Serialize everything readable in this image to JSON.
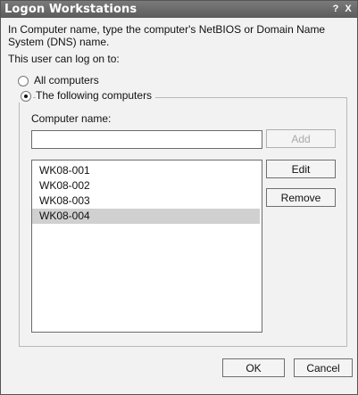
{
  "window": {
    "title": "Logon Workstations",
    "help_glyph": "?",
    "close_glyph": "X"
  },
  "description": "In Computer name, type the computer's NetBIOS or Domain Name System (DNS) name.",
  "can_log_on_label": "This user can log on to:",
  "options": {
    "all_label": "All computers",
    "following_label": "The following computers",
    "selected": "following"
  },
  "computer_name": {
    "label": "Computer name:",
    "value": ""
  },
  "buttons": {
    "add": "Add",
    "edit": "Edit",
    "remove": "Remove",
    "ok": "OK",
    "cancel": "Cancel"
  },
  "computers": [
    "WK08-001",
    "WK08-002",
    "WK08-003",
    "WK08-004"
  ],
  "selected_computer": "WK08-004"
}
